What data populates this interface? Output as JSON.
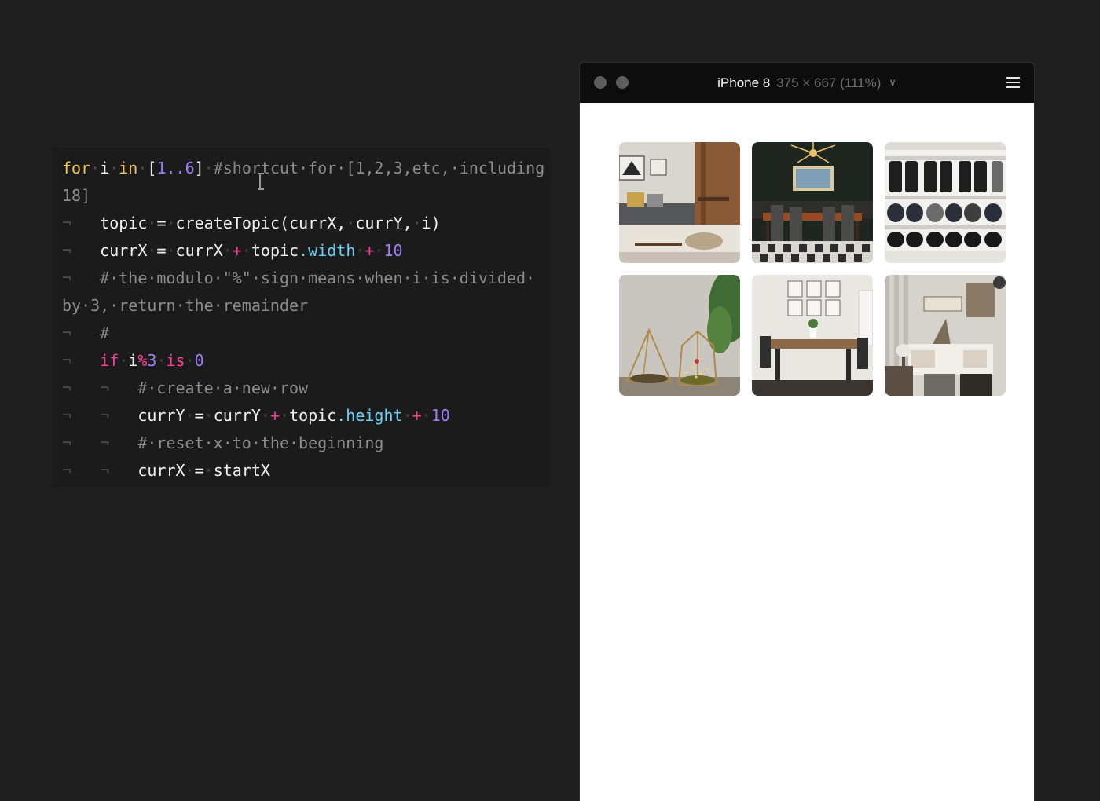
{
  "editor": {
    "lines": [
      [
        {
          "c": "t-kw",
          "t": "for"
        },
        {
          "c": "t-ws",
          "t": "·"
        },
        {
          "c": "t-pl",
          "t": "i"
        },
        {
          "c": "t-ws",
          "t": "·"
        },
        {
          "c": "t-kw",
          "t": "in"
        },
        {
          "c": "t-ws",
          "t": "·"
        },
        {
          "c": "t-par",
          "t": "["
        },
        {
          "c": "t-num",
          "t": "1..6"
        },
        {
          "c": "t-par",
          "t": "]"
        },
        {
          "c": "t-ws",
          "t": "·"
        },
        {
          "c": "t-cm",
          "t": "#shortcut·for·[1,2,3,etc,·including"
        }
      ],
      [
        {
          "c": "t-cm",
          "t": "18]"
        }
      ],
      [
        {
          "c": "t-ws",
          "t": "¬   "
        },
        {
          "c": "t-pl",
          "t": "topic"
        },
        {
          "c": "t-ws",
          "t": "·"
        },
        {
          "c": "t-pl",
          "t": "="
        },
        {
          "c": "t-ws",
          "t": "·"
        },
        {
          "c": "t-pl",
          "t": "createTopic(currX,"
        },
        {
          "c": "t-ws",
          "t": "·"
        },
        {
          "c": "t-pl",
          "t": "currY,"
        },
        {
          "c": "t-ws",
          "t": "·"
        },
        {
          "c": "t-pl",
          "t": "i)"
        }
      ],
      [
        {
          "c": "t-ws",
          "t": "¬   "
        },
        {
          "c": "t-pl",
          "t": "currX"
        },
        {
          "c": "t-ws",
          "t": "·"
        },
        {
          "c": "t-pl",
          "t": "="
        },
        {
          "c": "t-ws",
          "t": "·"
        },
        {
          "c": "t-pl",
          "t": "currX"
        },
        {
          "c": "t-ws",
          "t": "·"
        },
        {
          "c": "t-op",
          "t": "+"
        },
        {
          "c": "t-ws",
          "t": "·"
        },
        {
          "c": "t-pl",
          "t": "topic"
        },
        {
          "c": "t-prop",
          "t": ".width"
        },
        {
          "c": "t-ws",
          "t": "·"
        },
        {
          "c": "t-op",
          "t": "+"
        },
        {
          "c": "t-ws",
          "t": "·"
        },
        {
          "c": "t-num",
          "t": "10"
        }
      ],
      [
        {
          "c": "t-ws",
          "t": "¬   "
        },
        {
          "c": "t-cm",
          "t": "#·the·modulo·\"%\"·sign·means·when·i·is·divided·"
        }
      ],
      [
        {
          "c": "t-cm",
          "t": "by·3,·return·the·remainder"
        }
      ],
      [
        {
          "c": "t-ws",
          "t": "¬   "
        },
        {
          "c": "t-cm",
          "t": "#"
        }
      ],
      [
        {
          "c": "t-ws",
          "t": "¬   "
        },
        {
          "c": "t-op",
          "t": "if"
        },
        {
          "c": "t-ws",
          "t": "·"
        },
        {
          "c": "t-pl",
          "t": "i"
        },
        {
          "c": "t-op",
          "t": "%"
        },
        {
          "c": "t-num",
          "t": "3"
        },
        {
          "c": "t-ws",
          "t": "·"
        },
        {
          "c": "t-op",
          "t": "is"
        },
        {
          "c": "t-ws",
          "t": "·"
        },
        {
          "c": "t-num",
          "t": "0"
        }
      ],
      [
        {
          "c": "t-ws",
          "t": "¬   ¬   "
        },
        {
          "c": "t-cm",
          "t": "#·create·a·new·row"
        }
      ],
      [
        {
          "c": "t-ws",
          "t": "¬   ¬   "
        },
        {
          "c": "t-pl",
          "t": "currY"
        },
        {
          "c": "t-ws",
          "t": "·"
        },
        {
          "c": "t-pl",
          "t": "="
        },
        {
          "c": "t-ws",
          "t": "·"
        },
        {
          "c": "t-pl",
          "t": "currY"
        },
        {
          "c": "t-ws",
          "t": "·"
        },
        {
          "c": "t-op",
          "t": "+"
        },
        {
          "c": "t-ws",
          "t": "·"
        },
        {
          "c": "t-pl",
          "t": "topic"
        },
        {
          "c": "t-prop",
          "t": ".height"
        },
        {
          "c": "t-ws",
          "t": "·"
        },
        {
          "c": "t-op",
          "t": "+"
        },
        {
          "c": "t-ws",
          "t": "·"
        },
        {
          "c": "t-num",
          "t": "10"
        }
      ],
      [
        {
          "c": "t-ws",
          "t": "¬   ¬   "
        },
        {
          "c": "t-cm",
          "t": "#·reset·x·to·the·beginning"
        }
      ],
      [
        {
          "c": "t-ws",
          "t": "¬   ¬   "
        },
        {
          "c": "t-pl",
          "t": "currX"
        },
        {
          "c": "t-ws",
          "t": "·"
        },
        {
          "c": "t-pl",
          "t": "="
        },
        {
          "c": "t-ws",
          "t": "·"
        },
        {
          "c": "t-pl",
          "t": "startX"
        }
      ]
    ]
  },
  "preview": {
    "device_name": "iPhone 8",
    "device_dims": "375 × 667 (111%)",
    "tiles": [
      {
        "name": "photo-living-room"
      },
      {
        "name": "photo-dining-room-dark"
      },
      {
        "name": "photo-shoe-shelves"
      },
      {
        "name": "photo-glass-terrariums"
      },
      {
        "name": "photo-farmhouse-dining-table"
      },
      {
        "name": "photo-rustic-entryway"
      }
    ]
  },
  "colors": {
    "background": "#1f1f1f",
    "editor_bg": "#1b1b1b",
    "keyword": "#f5c84c",
    "number": "#9f7dfa",
    "operator": "#ff3e9b",
    "property": "#6bd0f5",
    "comment": "#8c8c8c"
  }
}
